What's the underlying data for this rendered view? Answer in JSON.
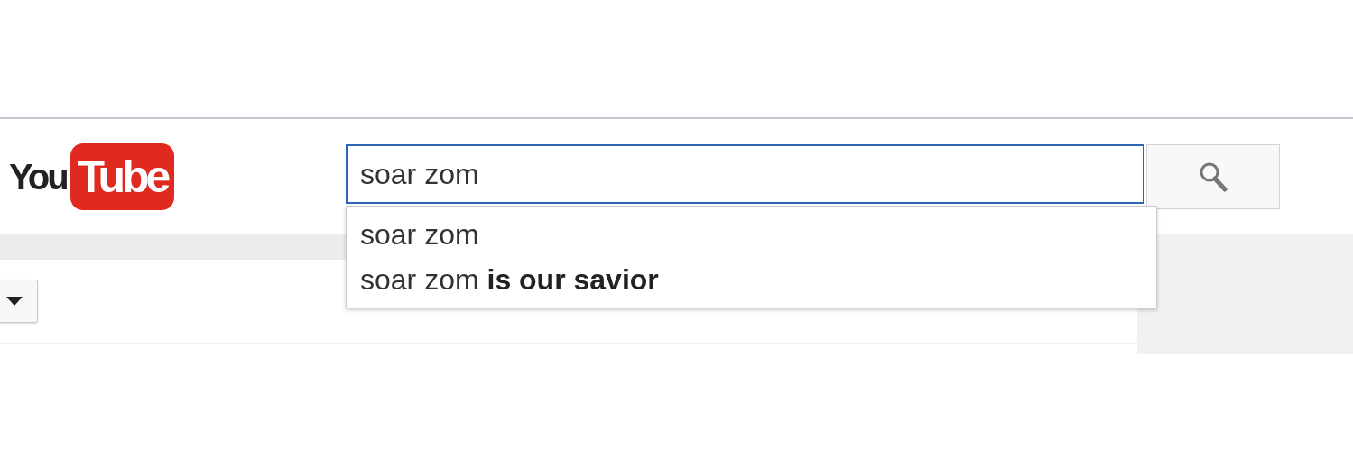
{
  "logo": {
    "word": "You",
    "badge": "Tube"
  },
  "search": {
    "value": "soar zom",
    "focused": true
  },
  "suggestions": [
    {
      "text": "soar zom"
    },
    {
      "text": "soar zom **is our savior**"
    }
  ],
  "filter": {
    "open": false
  }
}
